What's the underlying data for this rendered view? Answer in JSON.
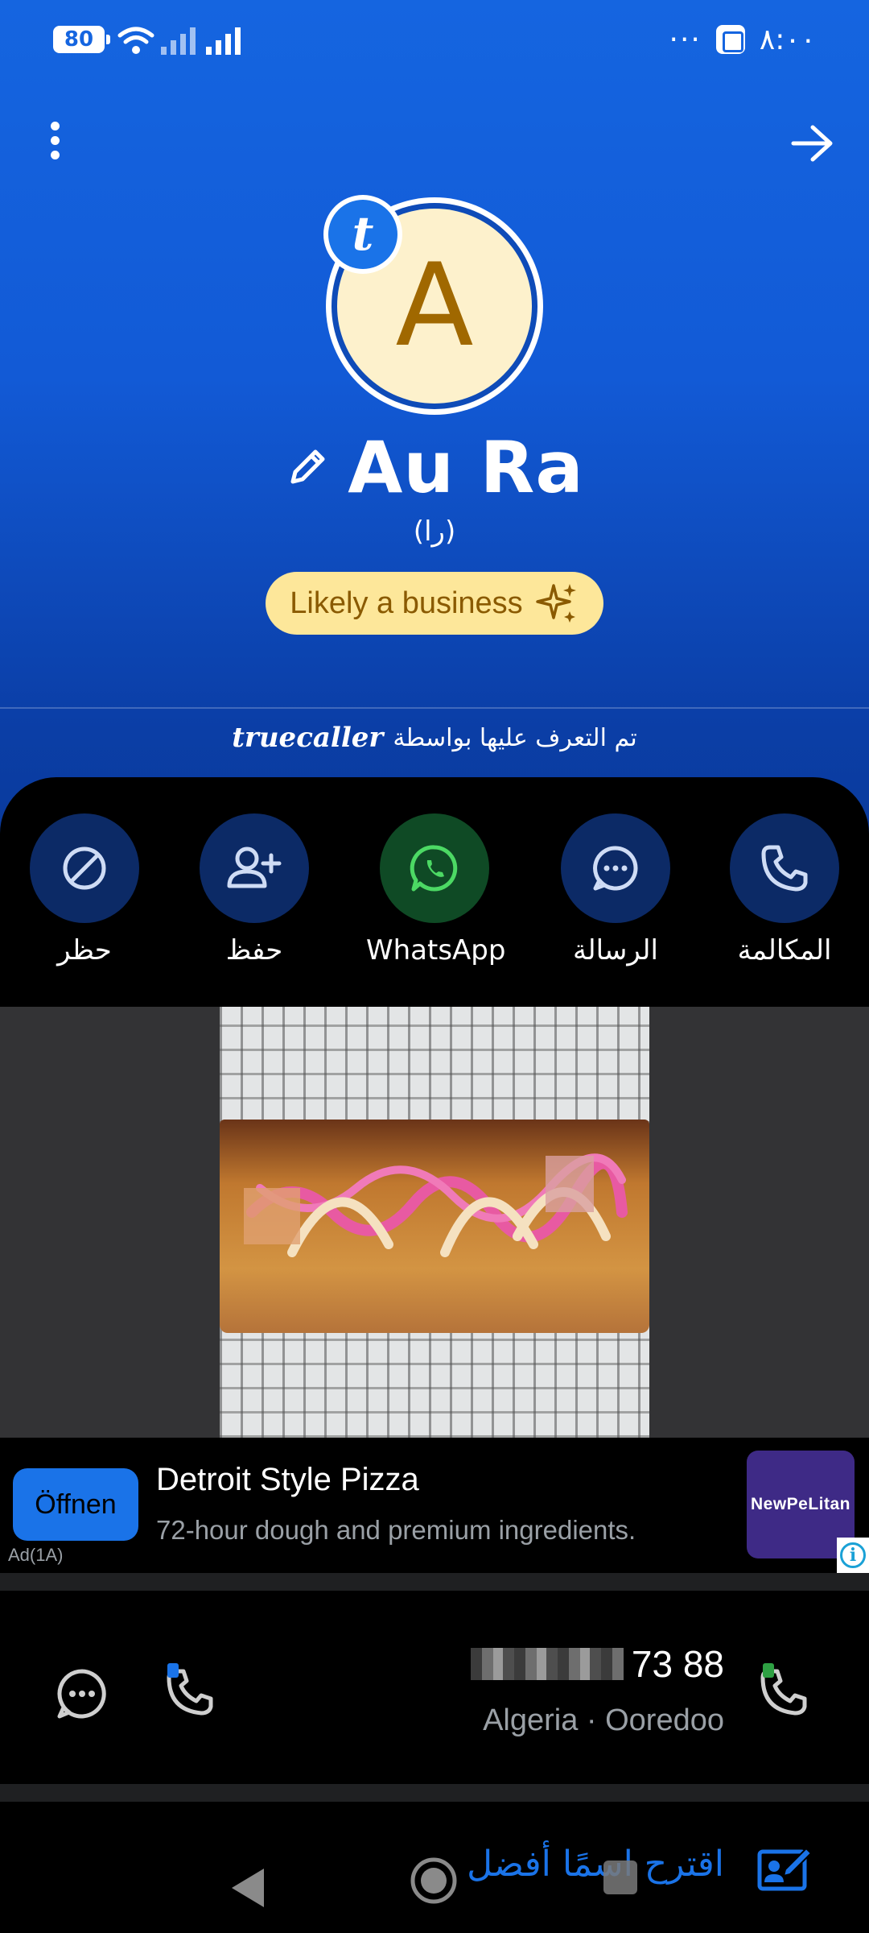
{
  "status_bar": {
    "battery": "80",
    "time": "٨:٠٠",
    "dots": "···"
  },
  "profile": {
    "avatar_letter": "A",
    "badge_letter": "t",
    "name": "Au Ra",
    "alt_name": "(را)",
    "business_tag": "Likely a business"
  },
  "identified": {
    "brand": "truecaller",
    "text": "تم التعرف عليها بواسطة"
  },
  "actions": {
    "block": "حظر",
    "save": "حفظ",
    "whatsapp": "WhatsApp",
    "message": "الرسالة",
    "call": "المكالمة"
  },
  "ad": {
    "open_button": "Öffnen",
    "title": "Detroit Style Pizza",
    "description": "72-hour dough and premium ingredients.",
    "label": "Ad(1A)",
    "logo_text": "NewPeLitan",
    "info": "i"
  },
  "phone": {
    "number_visible": "73 88",
    "carrier": "Algeria · Ooredoo"
  },
  "suggest": {
    "label": "اقترح اسمًا أفضل"
  },
  "colors": {
    "header_blue": "#1565e0",
    "action_circle": "#0c2a66",
    "whatsapp_circle": "#0f4a25",
    "accent_blue": "#1a73e8",
    "business_pill": "#fde79a"
  }
}
